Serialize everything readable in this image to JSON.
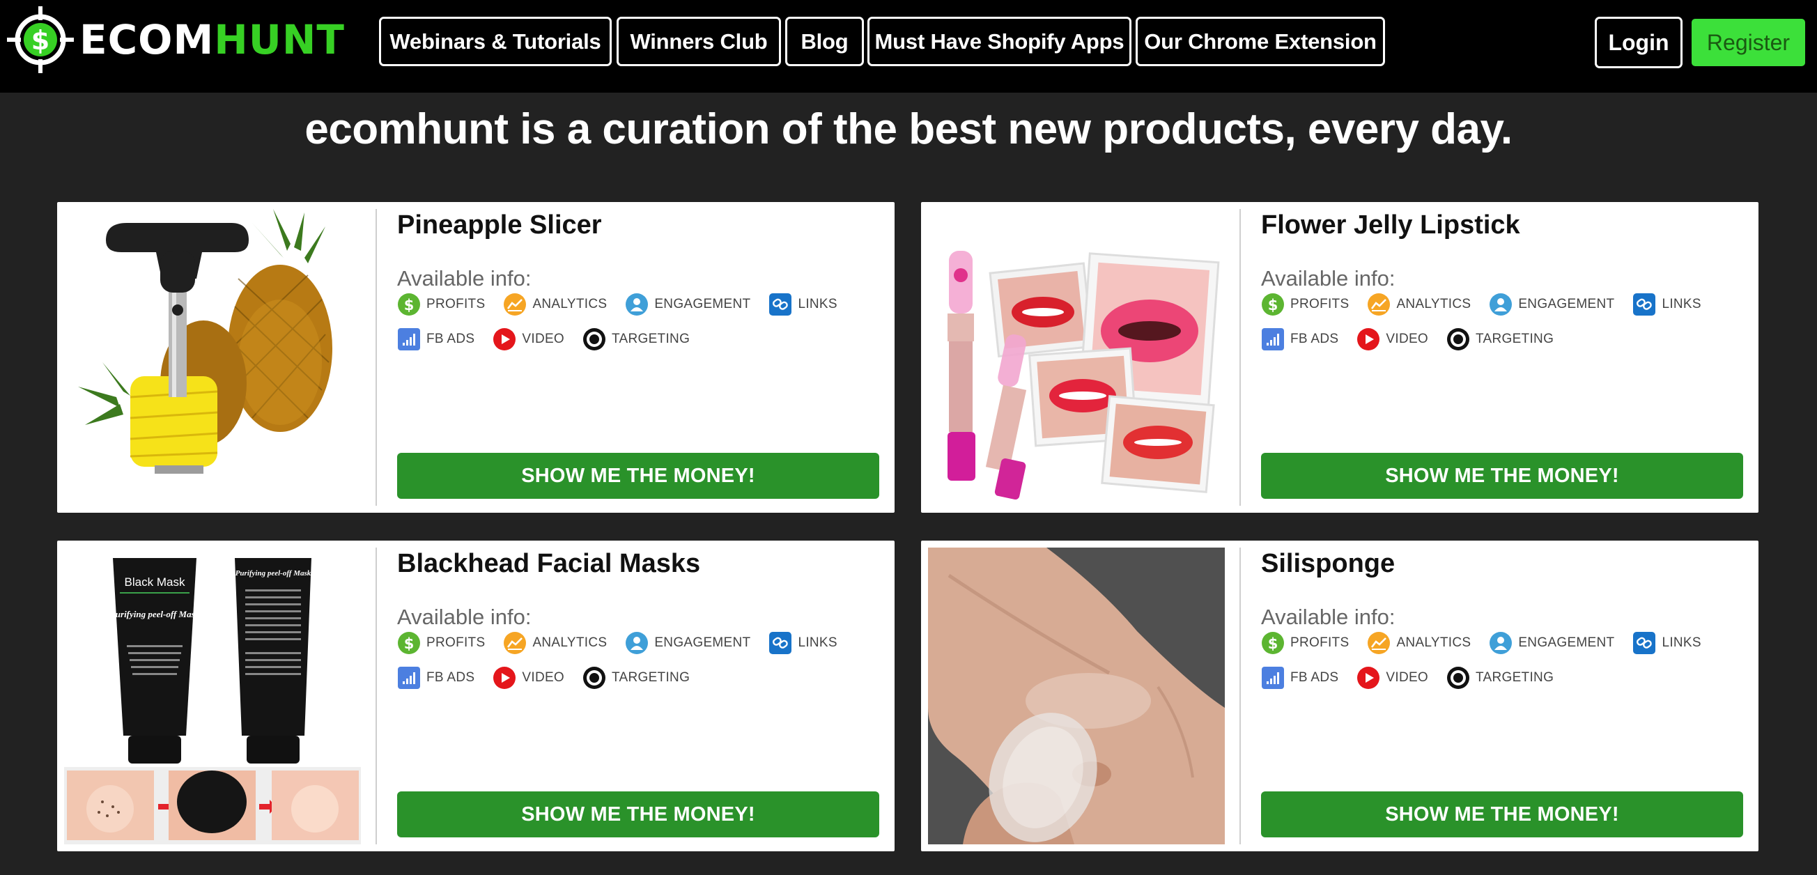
{
  "brand": {
    "logo_white": "ECOM",
    "logo_green": "HUNT"
  },
  "nav": [
    {
      "label": "Webinars & Tutorials"
    },
    {
      "label": "Winners Club"
    },
    {
      "label": "Blog"
    },
    {
      "label": "Must Have Shopify Apps"
    },
    {
      "label": "Our Chrome Extension"
    }
  ],
  "auth": {
    "login": "Login",
    "register": "Register"
  },
  "tagline": "ecomhunt is a curation of the best new products, every day.",
  "labels": {
    "available": "Available info:",
    "profits": "PROFITS",
    "analytics": "ANALYTICS",
    "engagement": "ENGAGEMENT",
    "links": "LINKS",
    "fb_ads": "FB ADS",
    "video": "VIDEO",
    "targeting": "TARGETING",
    "cta": "SHOW ME THE MONEY!"
  },
  "products": [
    {
      "title": "Pineapple Slicer"
    },
    {
      "title": "Flower Jelly Lipstick"
    },
    {
      "title": "Blackhead Facial Masks"
    },
    {
      "title": "Silisponge"
    }
  ],
  "mask_image_text": {
    "front": "Black Mask",
    "sub": "Purifying peel-off Mask",
    "back": "Purifying peel-off Mask"
  },
  "colors": {
    "accent_green": "#37d024",
    "cta_green": "#2a922a",
    "register_green": "#3ce03a",
    "page_bg": "#222222"
  }
}
